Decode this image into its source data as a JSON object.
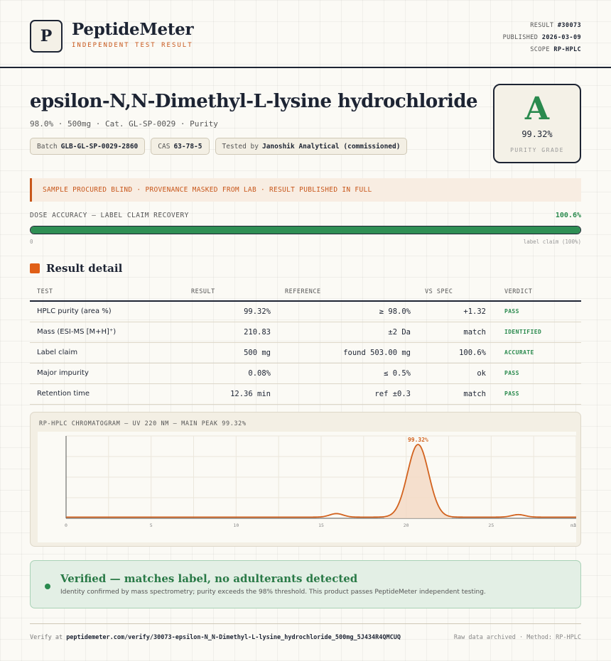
{
  "header": {
    "logo_letter": "P",
    "brand": "PeptideMeter",
    "tagline": "INDEPENDENT TEST RESULT",
    "result_label": "RESULT",
    "result_id": "#30073",
    "published_label": "PUBLISHED",
    "published_date": "2026-03-09",
    "scope_label": "SCOPE",
    "scope": "RP-HPLC"
  },
  "product": {
    "name": "epsilon-N,N-Dimethyl-L-lysine hydrochloride",
    "subline": "98.0% · 500mg · Cat. GL-SP-0029 · Purity",
    "chips": [
      {
        "label": "Batch",
        "value": "GLB-GL-SP-0029-2860"
      },
      {
        "label": "CAS",
        "value": "63-78-5"
      },
      {
        "label": "Tested by",
        "value": "Janoshik Analytical (commissioned)"
      }
    ]
  },
  "grade": {
    "letter": "A",
    "purity": "99.32%",
    "label": "PURITY GRADE"
  },
  "notice": "SAMPLE PROCURED BLIND · PROVENANCE MASKED FROM LAB · RESULT PUBLISHED IN FULL",
  "dose": {
    "label": "DOSE ACCURACY — LABEL CLAIM RECOVERY",
    "value": "100.6%",
    "fill_fraction": 1.0,
    "min_label": "0",
    "max_label": "label claim (100%)"
  },
  "section_title": "Result detail",
  "table": {
    "headers": [
      "TEST",
      "RESULT",
      "REFERENCE",
      "VS SPEC",
      "VERDICT"
    ],
    "rows": [
      {
        "test": "HPLC purity (area %)",
        "result": "99.32%",
        "reference": "≥ 98.0%",
        "vs_spec": "+1.32",
        "verdict": "PASS"
      },
      {
        "test": "Mass (ESI-MS [M+H]⁺)",
        "result": "210.83",
        "reference": "±2 Da",
        "vs_spec": "match",
        "verdict": "IDENTIFIED"
      },
      {
        "test": "Label claim",
        "result": "500 mg",
        "reference": "found 503.00 mg",
        "vs_spec": "100.6%",
        "verdict": "ACCURATE"
      },
      {
        "test": "Major impurity",
        "result": "0.08%",
        "reference": "≤ 0.5%",
        "vs_spec": "ok",
        "verdict": "PASS"
      },
      {
        "test": "Retention time",
        "result": "12.36 min",
        "reference": "ref ±0.3",
        "vs_spec": "match",
        "verdict": "PASS"
      }
    ]
  },
  "chart_title": "RP-HPLC CHROMATOGRAM — UV 220 NM — MAIN PEAK 99.32%",
  "chart_data": {
    "type": "line",
    "title": "RP-HPLC CHROMATOGRAM — UV 220 NM — MAIN PEAK 99.32%",
    "xlabel": "",
    "ylabel": "",
    "xlim": [
      0,
      30
    ],
    "ylim": [
      0,
      100
    ],
    "x_ticks": [
      "0",
      "5",
      "10",
      "15",
      "20",
      "25",
      "30"
    ],
    "x_tick_last_overlay": "min",
    "baseline": 1.5,
    "peaks": [
      {
        "center": 15.9,
        "height": 4.5,
        "width": 0.4
      },
      {
        "center": 20.7,
        "height": 93,
        "width": 0.62,
        "label": "99.32%"
      },
      {
        "center": 26.6,
        "height": 3.2,
        "width": 0.4
      }
    ],
    "line_color": "#d2621e",
    "fill_color": "#f3d9c6",
    "grid": true
  },
  "verified": {
    "title": "Verified — matches label, no adulterants detected",
    "text": "Identity confirmed by mass spectrometry; purity exceeds the 98% threshold. This product passes PeptideMeter independent testing."
  },
  "footer": {
    "verify_prefix": "Verify at",
    "verify_url": "peptidemeter.com/verify/30073-epsilon-N_N-Dimethyl-L-lysine_hydrochloride_500mg_5J434R4QMCUQ",
    "right": "Raw data archived · Method: RP-HPLC"
  }
}
